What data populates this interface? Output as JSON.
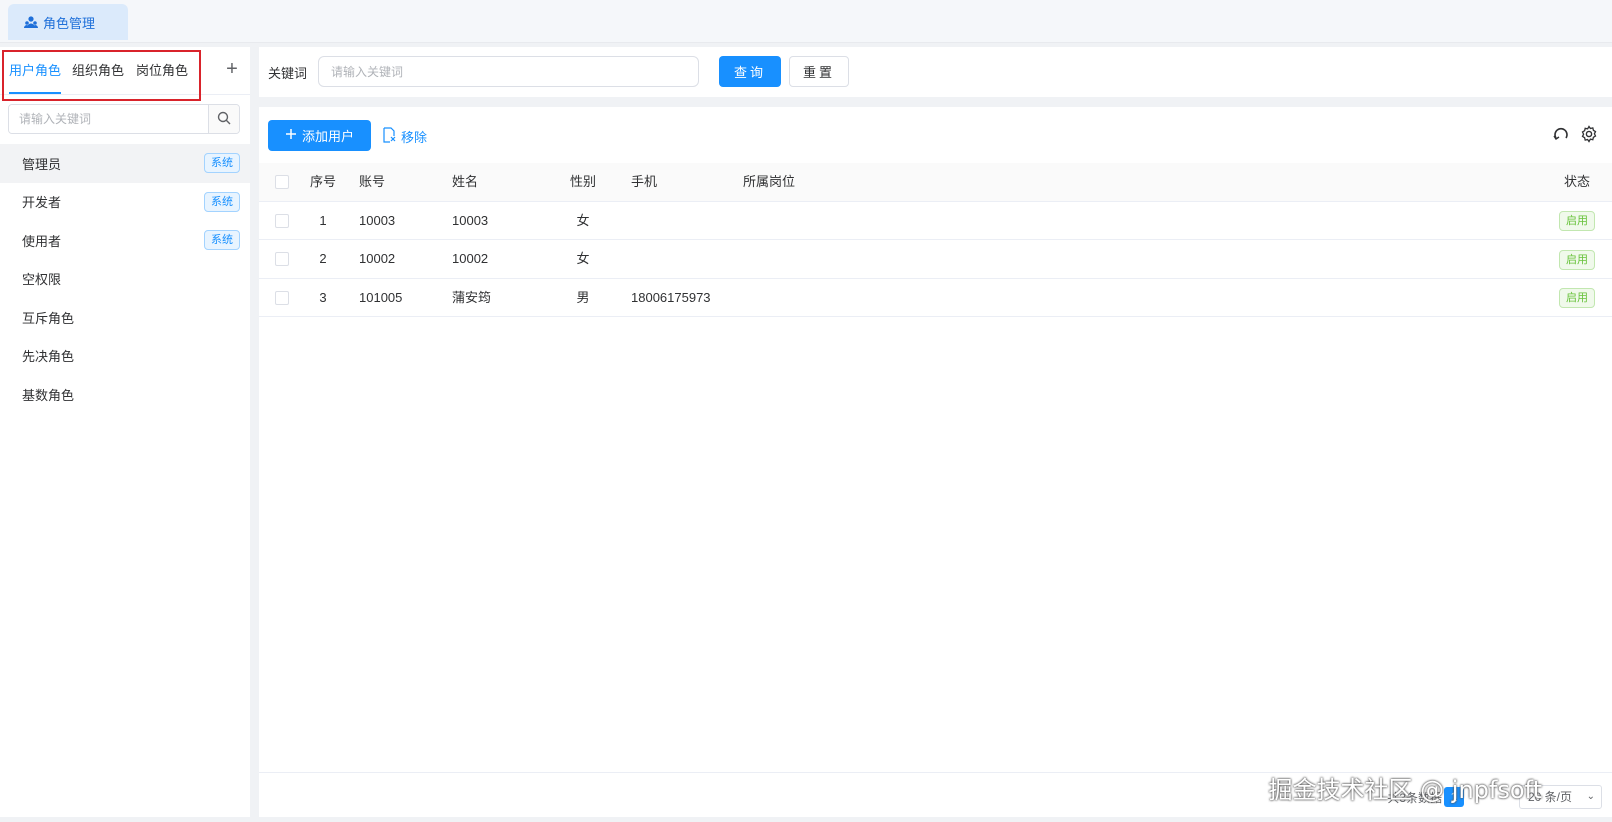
{
  "page_tab": {
    "label": "角色管理",
    "icon": "users-icon"
  },
  "left": {
    "tabs": [
      {
        "label": "用户角色",
        "active": true
      },
      {
        "label": "组织角色",
        "active": false
      },
      {
        "label": "岗位角色",
        "active": false
      }
    ],
    "add_icon": "+",
    "search_placeholder": "请输入关键词",
    "roles": [
      {
        "name": "管理员",
        "badge": "系统",
        "selected": true
      },
      {
        "name": "开发者",
        "badge": "系统"
      },
      {
        "name": "使用者",
        "badge": "系统"
      },
      {
        "name": "空权限"
      },
      {
        "name": "互斥角色"
      },
      {
        "name": "先决角色"
      },
      {
        "name": "基数角色"
      }
    ]
  },
  "query": {
    "label": "关键词",
    "placeholder": "请输入关键词",
    "search_label": "查询",
    "reset_label": "重置"
  },
  "toolbar": {
    "add_label": "添加用户",
    "remove_label": "移除"
  },
  "table": {
    "headers": {
      "index": "序号",
      "account": "账号",
      "name": "姓名",
      "sex": "性别",
      "phone": "手机",
      "post": "所属岗位",
      "status": "状态"
    },
    "rows": [
      {
        "index": "1",
        "account": "10003",
        "name": "10003",
        "sex": "女",
        "phone": "",
        "post": "",
        "status": "启用"
      },
      {
        "index": "2",
        "account": "10002",
        "name": "10002",
        "sex": "女",
        "phone": "",
        "post": "",
        "status": "启用"
      },
      {
        "index": "3",
        "account": "101005",
        "name": "蒲安筠",
        "sex": "男",
        "phone": "18006175973",
        "post": "",
        "status": "启用"
      }
    ]
  },
  "pagination": {
    "total_text": "共3条数据",
    "current_page": "1",
    "page_size": "20 条/页"
  },
  "watermark": "掘金技术社区 @ jnpfsoft",
  "colors": {
    "primary": "#1890ff",
    "success": "#67c23a",
    "highlight_border": "#d9232b"
  }
}
